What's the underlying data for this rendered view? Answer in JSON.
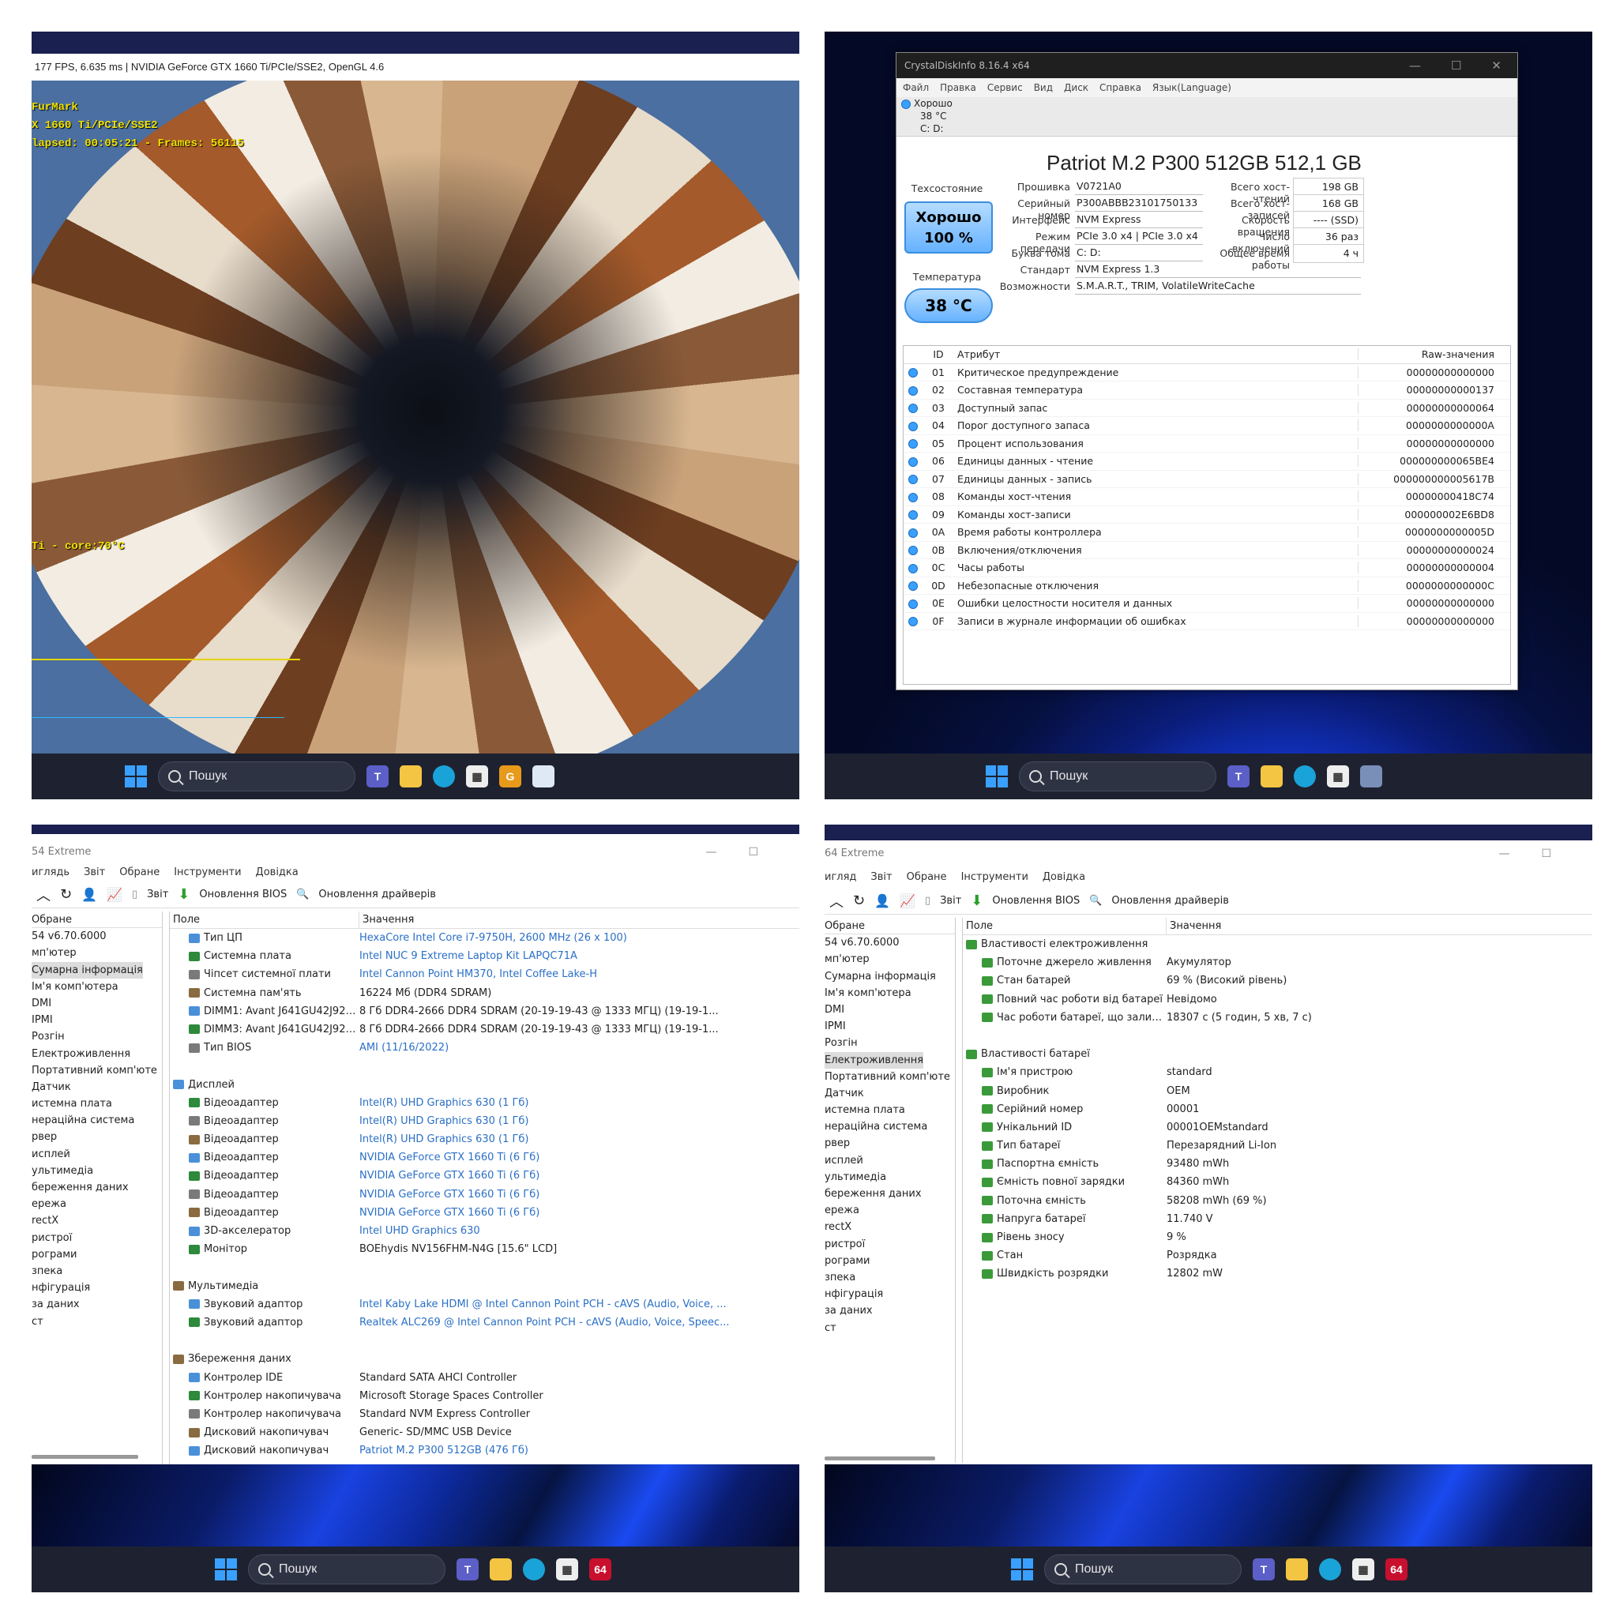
{
  "taskbar": {
    "search_label": "Пошук",
    "aida_badge": "64"
  },
  "furmark": {
    "title": "177 FPS, 6.635 ms | NVIDIA GeForce GTX 1660 Ti/PCIe/SSE2, OpenGL 4.6",
    "osd_line1": "FurMark",
    "osd_line2": "X 1660 Ti/PCIe/SSE2",
    "osd_line3": "lapsed: 00:05:21 - Frames: 56115",
    "osd_temp": "Ti - core:70°C"
  },
  "cdi": {
    "window_title": "CrystalDiskInfo 8.16.4 x64",
    "menu": [
      "Файл",
      "Правка",
      "Сервис",
      "Вид",
      "Диск",
      "Справка",
      "Язык(Language)"
    ],
    "drive_status": "Хорошо",
    "drive_temp": "38 °C",
    "drive_letter": "C: D:",
    "model": "Patriot M.2 P300 512GB 512,1 GB",
    "health_label": "Техсостояние",
    "health_status": "Хорошо",
    "health_percent": "100 %",
    "temp_label": "Температура",
    "temp_value": "38 °C",
    "fields": [
      {
        "label": "Прошивка",
        "value": "V0721A0"
      },
      {
        "label": "Серийный номер",
        "value": "P300ABBB23101750133"
      },
      {
        "label": "Интерфейс",
        "value": "NVM Express"
      },
      {
        "label": "Режим передачи",
        "value": "PCIe 3.0 x4 | PCIe 3.0 x4"
      },
      {
        "label": "Буква тома",
        "value": "C: D:"
      },
      {
        "label": "Стандарт",
        "value": "NVM Express 1.3"
      },
      {
        "label": "Возможности",
        "value": "S.M.A.R.T., TRIM, VolatileWriteCache"
      }
    ],
    "right_fields": [
      {
        "label": "Всего хост-чтений",
        "value": "198 GB"
      },
      {
        "label": "Всего хост-записей",
        "value": "168 GB"
      },
      {
        "label": "Скорость вращения",
        "value": "---- (SSD)"
      },
      {
        "label": "Число включений",
        "value": "36 раз"
      },
      {
        "label": "Общее время работы",
        "value": "4 ч"
      }
    ],
    "table_headers": {
      "id": "ID",
      "attr": "Атрибут",
      "raw": "Raw-значения"
    },
    "attributes": [
      {
        "id": "01",
        "name": "Критическое предупреждение",
        "raw": "00000000000000"
      },
      {
        "id": "02",
        "name": "Составная температура",
        "raw": "00000000000137"
      },
      {
        "id": "03",
        "name": "Доступный запас",
        "raw": "00000000000064"
      },
      {
        "id": "04",
        "name": "Порог доступного запаса",
        "raw": "0000000000000A"
      },
      {
        "id": "05",
        "name": "Процент использования",
        "raw": "00000000000000"
      },
      {
        "id": "06",
        "name": "Единицы данных - чтение",
        "raw": "000000000065BE4"
      },
      {
        "id": "07",
        "name": "Единицы данных - запись",
        "raw": "000000000005617B"
      },
      {
        "id": "08",
        "name": "Команды хост-чтения",
        "raw": "00000000418C74"
      },
      {
        "id": "09",
        "name": "Команды хост-записи",
        "raw": "000000002E6BD8"
      },
      {
        "id": "0A",
        "name": "Время работы контроллера",
        "raw": "0000000000005D"
      },
      {
        "id": "0B",
        "name": "Включения/отключения",
        "raw": "00000000000024"
      },
      {
        "id": "0C",
        "name": "Часы работы",
        "raw": "00000000000004"
      },
      {
        "id": "0D",
        "name": "Небезопасные отключения",
        "raw": "0000000000000C"
      },
      {
        "id": "0E",
        "name": "Ошибки целостности носителя и данных",
        "raw": "00000000000000"
      },
      {
        "id": "0F",
        "name": "Записи в журнале информации об ошибках",
        "raw": "00000000000000"
      }
    ]
  },
  "aida1": {
    "title": "54 Extreme",
    "menu": [
      "иглядь",
      "Звіт",
      "Обране",
      "Інструменти",
      "Довідка"
    ],
    "toolbar": {
      "report": "Звіт",
      "bios": "Оновлення BIOS",
      "drivers": "Оновлення драйверів"
    },
    "left_header": "Обране",
    "left": [
      "54 v6.70.6000",
      "мп'ютер",
      "Сумарна інформація",
      "Ім'я комп'ютера",
      "DMI",
      "IPMI",
      "Розгін",
      "Електроживлення",
      "Портативний комп'юте",
      "Датчик",
      "истемна плата",
      "нераційна система",
      "рвер",
      "исплей",
      "ультимедіа",
      "береження даних",
      "ережа",
      "rectX",
      "ристрої",
      "рограми",
      "зпека",
      "нфігурація",
      "за даних",
      "ст"
    ],
    "col_field": "Поле",
    "col_value": "Значення",
    "rows": [
      {
        "f": "Тип ЦП",
        "v": "HexaCore Intel Core i7-9750H, 2600 MHz (26 x 100)",
        "link": true
      },
      {
        "f": "Системна плата",
        "v": "Intel NUC 9 Extreme Laptop Kit LAPQC71A",
        "link": true
      },
      {
        "f": "Чіпсет системної плати",
        "v": "Intel Cannon Point HM370, Intel Coffee Lake-H",
        "link": true
      },
      {
        "f": "Системна пам'ять",
        "v": "16224 Мб  (DDR4 SDRAM)",
        "link": false
      },
      {
        "f": "DIMM1: Avant J641GU42J926...",
        "v": "8 Гб DDR4-2666 DDR4 SDRAM  (20-19-19-43 @ 1333 МГЦ)  (19-19-1...",
        "link": false
      },
      {
        "f": "DIMM3: Avant J641GU42J926...",
        "v": "8 Гб DDR4-2666 DDR4 SDRAM  (20-19-19-43 @ 1333 МГЦ)  (19-19-1...",
        "link": false
      },
      {
        "f": "Тип BIOS",
        "v": "AMI (11/16/2022)",
        "link": true
      },
      {
        "f": "",
        "v": "",
        "link": false
      },
      {
        "f": "Дисплей",
        "v": "",
        "link": false,
        "grp": true
      },
      {
        "f": "Відеоадаптер",
        "v": "Intel(R) UHD Graphics 630  (1 Гб)",
        "link": true
      },
      {
        "f": "Відеоадаптер",
        "v": "Intel(R) UHD Graphics 630  (1 Гб)",
        "link": true
      },
      {
        "f": "Відеоадаптер",
        "v": "Intel(R) UHD Graphics 630  (1 Гб)",
        "link": true
      },
      {
        "f": "Відеоадаптер",
        "v": "NVIDIA GeForce GTX 1660 Ti  (6 Гб)",
        "link": true
      },
      {
        "f": "Відеоадаптер",
        "v": "NVIDIA GeForce GTX 1660 Ti  (6 Гб)",
        "link": true
      },
      {
        "f": "Відеоадаптер",
        "v": "NVIDIA GeForce GTX 1660 Ti  (6 Гб)",
        "link": true
      },
      {
        "f": "Відеоадаптер",
        "v": "NVIDIA GeForce GTX 1660 Ti  (6 Гб)",
        "link": true
      },
      {
        "f": "3D-акселератор",
        "v": "Intel UHD Graphics 630",
        "link": true
      },
      {
        "f": "Монітор",
        "v": "BOEhydis NV156FHM-N4G  [15.6\" LCD]",
        "link": false
      },
      {
        "f": "",
        "v": "",
        "link": false
      },
      {
        "f": "Мультимедіа",
        "v": "",
        "link": false,
        "grp": true
      },
      {
        "f": "Звуковий адаптор",
        "v": "Intel Kaby Lake HDMI @ Intel Cannon Point PCH - cAVS (Audio, Voice, ...",
        "link": true
      },
      {
        "f": "Звуковий адаптор",
        "v": "Realtek ALC269 @ Intel Cannon Point PCH - cAVS (Audio, Voice, Speec...",
        "link": true
      },
      {
        "f": "",
        "v": "",
        "link": false
      },
      {
        "f": "Збереження даних",
        "v": "",
        "link": false,
        "grp": true
      },
      {
        "f": "Контролер IDE",
        "v": "Standard SATA AHCI Controller",
        "link": false
      },
      {
        "f": "Контролер накопичувача",
        "v": "Microsoft Storage Spaces Controller",
        "link": false
      },
      {
        "f": "Контролер накопичувача",
        "v": "Standard NVM Express Controller",
        "link": false
      },
      {
        "f": "Дисковий накопичувач",
        "v": "Generic- SD/MMC USB Device",
        "link": false
      },
      {
        "f": "Дисковий накопичувач",
        "v": "Patriot M.2 P300 512GB  (476 Гб)",
        "link": true
      }
    ]
  },
  "aida2": {
    "title": "64 Extreme",
    "menu": [
      "игляд",
      "Звіт",
      "Обране",
      "Інструменти",
      "Довідка"
    ],
    "toolbar": {
      "report": "Звіт",
      "bios": "Оновлення BIOS",
      "drivers": "Оновлення драйверів"
    },
    "left_header": "Обране",
    "left": [
      "54 v6.70.6000",
      "мп'ютер",
      "Сумарна інформація",
      "Ім'я комп'ютера",
      "DMI",
      "IPMI",
      "Розгін",
      "Електроживлення",
      "Портативний комп'юте",
      "Датчик",
      "истемна плата",
      "нераційна система",
      "рвер",
      "исплей",
      "ультимедіа",
      "береження даних",
      "ережа",
      "rectX",
      "ристрої",
      "рограми",
      "зпека",
      "нфігурація",
      "за даних",
      "ст"
    ],
    "col_field": "Поле",
    "col_value": "Значення",
    "rows": [
      {
        "f": "Властивості електроживлення",
        "v": "",
        "grp": true
      },
      {
        "f": "Поточне джерело живлення",
        "v": "Акумулятор"
      },
      {
        "f": "Стан батарей",
        "v": "69 % (Високий рівень)"
      },
      {
        "f": "Повний час роботи від батареї",
        "v": "Невідомо"
      },
      {
        "f": "Час роботи батареї, що залиш...",
        "v": "18307 с (5 годин, 5 хв, 7 с)"
      },
      {
        "f": "",
        "v": ""
      },
      {
        "f": "Властивості батареї",
        "v": "",
        "grp": true
      },
      {
        "f": "Ім'я пристрою",
        "v": "standard"
      },
      {
        "f": "Виробник",
        "v": "OEM"
      },
      {
        "f": "Серійний номер",
        "v": "00001"
      },
      {
        "f": "Унікальний ID",
        "v": "00001OEMstandard"
      },
      {
        "f": "Тип батареї",
        "v": "Перезарядний Li-Ion"
      },
      {
        "f": "Паспортна ємність",
        "v": "93480 mWh"
      },
      {
        "f": "Ємність повної зарядки",
        "v": "84360 mWh"
      },
      {
        "f": "Поточна ємність",
        "v": "58208 mWh  (69 %)"
      },
      {
        "f": "Напруга батареї",
        "v": "11.740 V"
      },
      {
        "f": "Рівень зносу",
        "v": "9 %"
      },
      {
        "f": "Стан",
        "v": "Розрядка"
      },
      {
        "f": "Швидкість розрядки",
        "v": "12802 mW"
      }
    ]
  }
}
